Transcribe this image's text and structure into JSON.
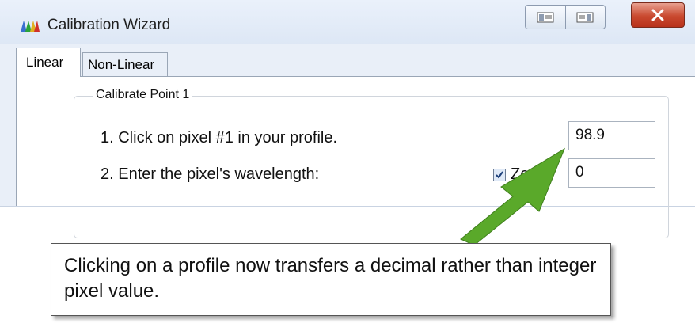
{
  "window": {
    "title": "Calibration Wizard",
    "close_label": "x",
    "accent_color": "#c9492f"
  },
  "tabs": [
    {
      "label": "Linear",
      "selected": true
    },
    {
      "label": "Non-Linear",
      "selected": false
    }
  ],
  "group": {
    "legend": "Calibrate Point 1",
    "step1_text": "1. Click on pixel #1 in your profile.",
    "step1_value": "98.9",
    "step2_text": "2. Enter the pixel's wavelength:",
    "step2_value": "0",
    "checkbox_label": "Ze",
    "checkbox_checked": true
  },
  "callout": {
    "text": "Clicking on a profile now transfers a decimal rather than integer pixel value.",
    "arrow_color": "#5aa92a"
  },
  "icons": {
    "app": "spectrum-icon",
    "tb1": "restore-left-icon",
    "tb2": "restore-right-icon",
    "close": "close-icon",
    "check": "checkmark-icon"
  }
}
